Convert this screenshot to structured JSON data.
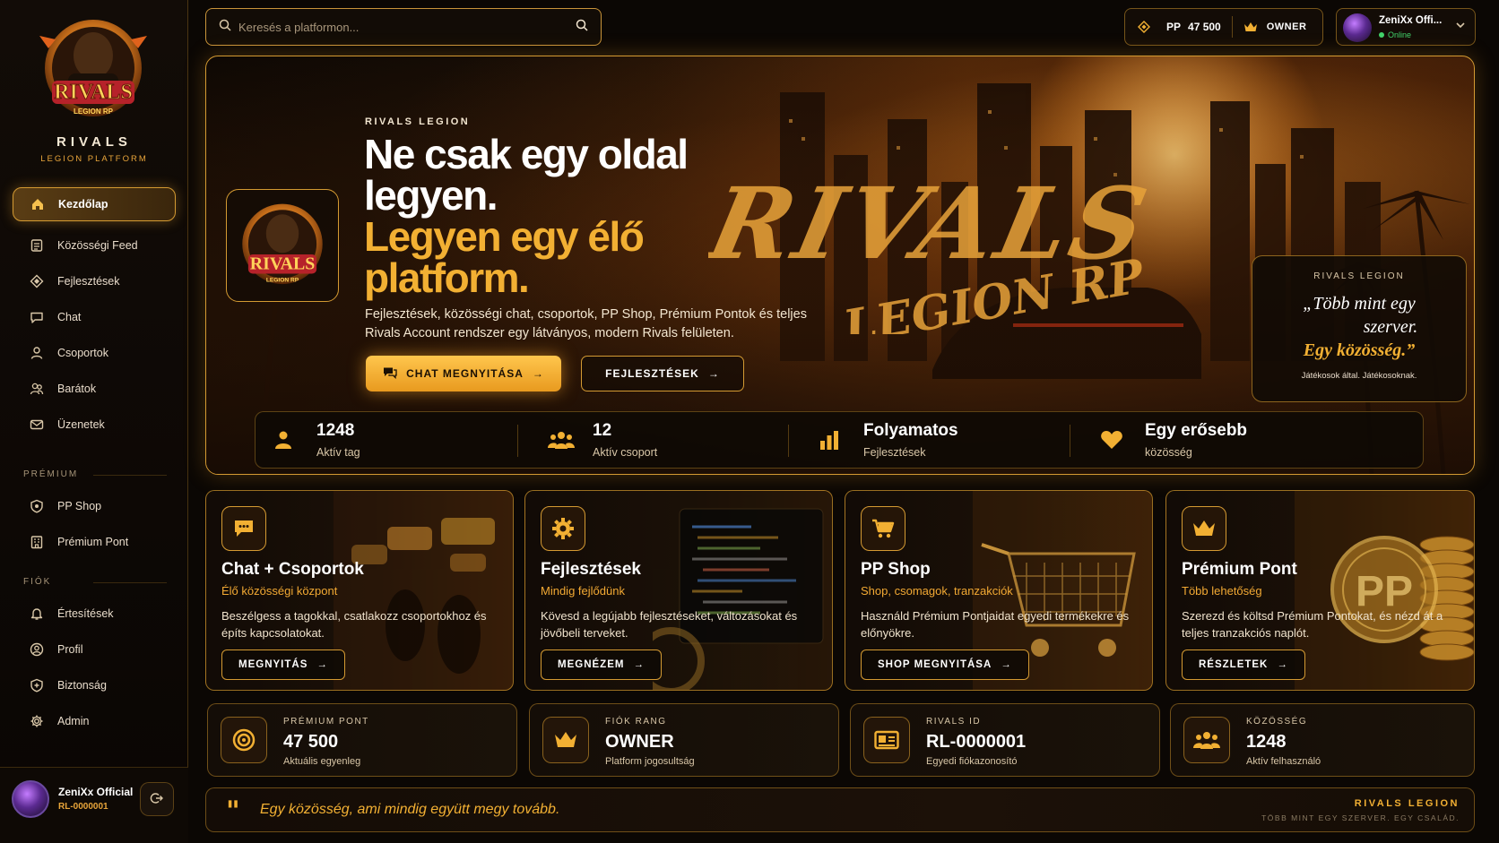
{
  "brand": {
    "title": "RIVALS",
    "subtitle": "LEGION PLATFORM",
    "logo_text": "RIVALS",
    "logo_subtext": "LEGION RP"
  },
  "sidebar": {
    "items": [
      {
        "label": "Kezdőlap",
        "icon": "home-icon"
      },
      {
        "label": "Közösségi Feed",
        "icon": "feed-icon"
      },
      {
        "label": "Fejlesztések",
        "icon": "diamond-icon"
      },
      {
        "label": "Chat",
        "icon": "chat-icon"
      },
      {
        "label": "Csoportok",
        "icon": "user-icon"
      },
      {
        "label": "Barátok",
        "icon": "friends-icon"
      },
      {
        "label": "Üzenetek",
        "icon": "mail-icon"
      }
    ],
    "premium_label": "PRÉMIUM",
    "premium_items": [
      {
        "label": "PP Shop",
        "icon": "shield-icon"
      },
      {
        "label": "Prémium Pont",
        "icon": "building-icon"
      }
    ],
    "account_label": "FIÓK",
    "account_items": [
      {
        "label": "Értesítések",
        "icon": "bell-icon"
      },
      {
        "label": "Profil",
        "icon": "profile-icon"
      },
      {
        "label": "Biztonság",
        "icon": "shield-plus-icon"
      },
      {
        "label": "Admin",
        "icon": "gear-icon"
      }
    ],
    "user": {
      "name": "ZeniXx Official",
      "id": "RL-0000001"
    }
  },
  "topbar": {
    "search_placeholder": "Keresés a platformon...",
    "pp_label": "PP",
    "pp_value": "47 500",
    "rank": "OWNER",
    "user_name": "ZeniXx Offi...",
    "user_status": "Online"
  },
  "hero": {
    "eyebrow": "RIVALS LEGION",
    "headline_white_1": "Ne csak egy oldal",
    "headline_white_2": "legyen.",
    "headline_gold_1": "Legyen egy élő",
    "headline_gold_2": "platform.",
    "description": "Fejlesztések, közösségi chat, csoportok, PP Shop, Prémium Pontok és teljes Rivals Account rendszer egy látványos, modern Rivals felületen.",
    "btn_chat": "CHAT MEGNYITÁSA",
    "btn_dev": "FEJLESZTÉSEK",
    "art_text_1": "RIVALS",
    "art_text_2": "LEGION RP",
    "quote": {
      "eyebrow": "RIVALS LEGION",
      "line1": "„Több mint egy",
      "line2": "szerver.",
      "line3": "Egy közösség.”",
      "small": "Játékosok által. Játékosoknak."
    },
    "stats": [
      {
        "value": "1248",
        "label": "Aktív tag",
        "icon": "users-icon"
      },
      {
        "value": "12",
        "label": "Aktív csoport",
        "icon": "group-icon"
      },
      {
        "value": "Folyamatos",
        "label": "Fejlesztések",
        "icon": "bar-chart-icon"
      },
      {
        "value": "Egy erősebb",
        "label": "közösség",
        "icon": "heart-icon"
      }
    ]
  },
  "cards": [
    {
      "title": "Chat + Csoportok",
      "subtitle": "Élő közösségi központ",
      "desc": "Beszélgess a tagokkal, csatlakozz csoportokhoz és építs kapcsolatokat.",
      "btn": "MEGNYITÁS",
      "icon": "chat-bubble-icon"
    },
    {
      "title": "Fejlesztések",
      "subtitle": "Mindig fejlődünk",
      "desc": "Kövesd a legújabb fejlesztéseket, változásokat és jövőbeli terveket.",
      "btn": "MEGNÉZEM",
      "icon": "gear-icon"
    },
    {
      "title": "PP Shop",
      "subtitle": "Shop, csomagok, tranzakciók",
      "desc": "Használd Prémium Pontjaidat egyedi termékekre és előnyökre.",
      "btn": "SHOP MEGNYITÁSA",
      "icon": "cart-icon"
    },
    {
      "title": "Prémium Pont",
      "subtitle": "Több lehetőség",
      "desc": "Szerezd és költsd Prémium Pontokat, és nézd át a teljes tranzakciós naplót.",
      "btn": "RÉSZLETEK",
      "icon": "crown-icon",
      "coin_text": "PP"
    }
  ],
  "tiles": [
    {
      "label": "PRÉMIUM PONT",
      "value": "47 500",
      "sub": "Aktuális egyenleg",
      "icon": "coin-icon"
    },
    {
      "label": "FIÓK RANG",
      "value": "OWNER",
      "sub": "Platform jogosultság",
      "icon": "crown-icon"
    },
    {
      "label": "RIVALS ID",
      "value": "RL-0000001",
      "sub": "Egyedi fiókazonosító",
      "icon": "id-card-icon"
    },
    {
      "label": "KÖZÖSSÉG",
      "value": "1248",
      "sub": "Aktív felhasználó",
      "icon": "community-icon"
    }
  ],
  "banner": {
    "text": "Egy közösség, ami mindig együtt megy tovább.",
    "right_title": "RIVALS LEGION",
    "right_sub": "TÖBB MINT EGY SZERVER. EGY CSALÁD."
  },
  "colors": {
    "accent": "#f2b033",
    "background": "#0b0704",
    "online": "#42d36b"
  }
}
